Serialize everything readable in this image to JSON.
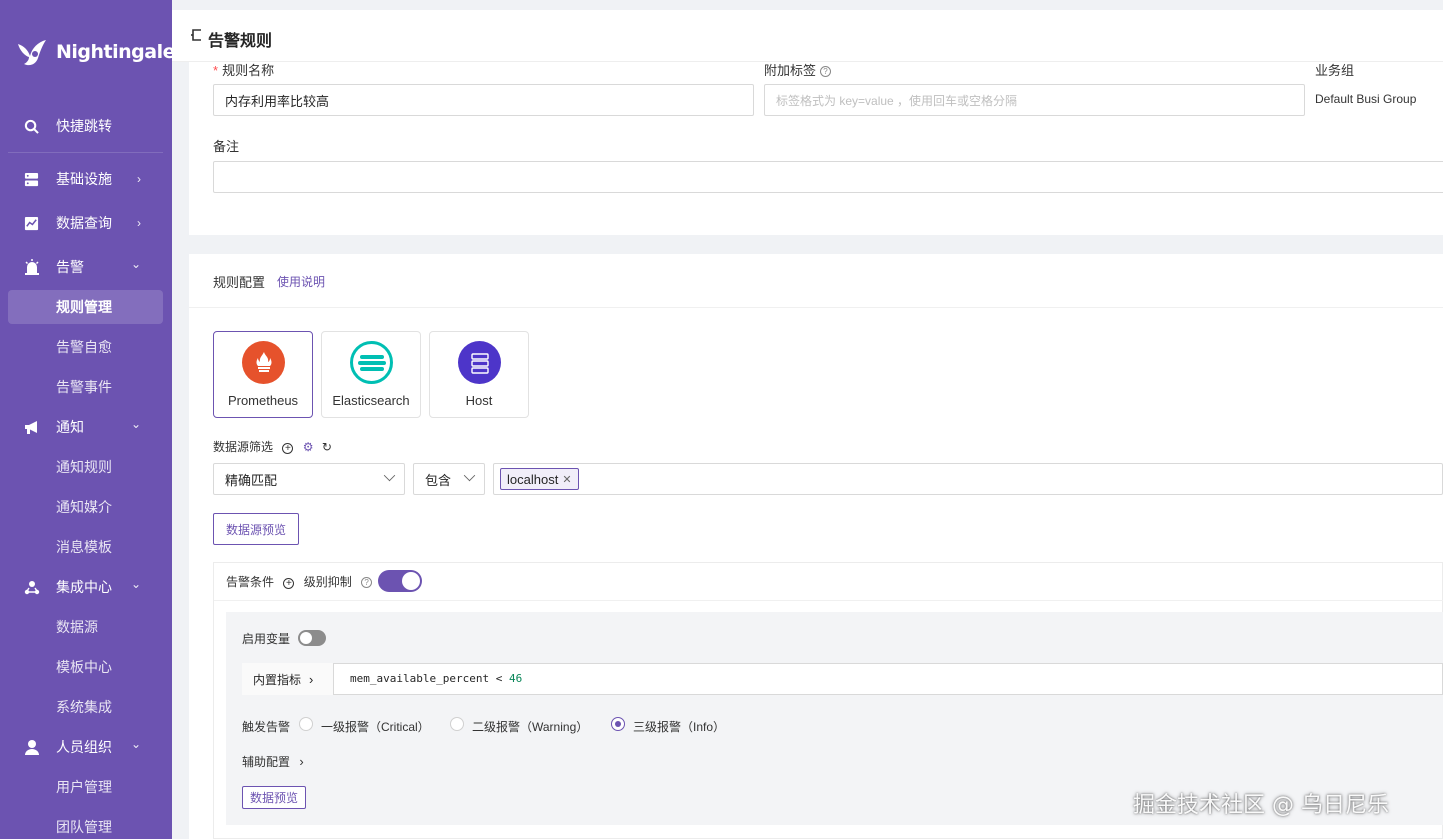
{
  "app": {
    "name": "Nightingale"
  },
  "colors": {
    "brand": "#6c53b1",
    "prometheus": "#e6522c",
    "elasticsearch": "#00bfb3",
    "host": "#4d35c9"
  },
  "sidebar": {
    "items": [
      {
        "label": "快捷跳转",
        "icon": "search-icon"
      },
      {
        "label": "基础设施",
        "icon": "server-icon",
        "chevron": "›"
      },
      {
        "label": "数据查询",
        "icon": "chart-icon",
        "chevron": "›"
      },
      {
        "label": "告警",
        "icon": "alarm-icon",
        "chevron": "⌄"
      },
      {
        "label": "规则管理",
        "active": true
      },
      {
        "label": "告警自愈"
      },
      {
        "label": "告警事件"
      },
      {
        "label": "通知",
        "icon": "megaphone-icon",
        "chevron": "⌄"
      },
      {
        "label": "通知规则"
      },
      {
        "label": "通知媒介"
      },
      {
        "label": "消息模板"
      },
      {
        "label": "集成中心",
        "icon": "integration-icon",
        "chevron": "⌄"
      },
      {
        "label": "数据源"
      },
      {
        "label": "模板中心"
      },
      {
        "label": "系统集成"
      },
      {
        "label": "人员组织",
        "icon": "user-icon",
        "chevron": "⌄"
      },
      {
        "label": "用户管理"
      },
      {
        "label": "团队管理"
      }
    ]
  },
  "header": {
    "back_icon": "back-icon",
    "title": "告警规则"
  },
  "basic": {
    "rule_name_label": "规则名称",
    "rule_name_value": "内存利用率比较高",
    "tags_label": "附加标签",
    "tags_placeholder": "标签格式为 key=value ，使用回车或空格分隔",
    "group_label": "业务组",
    "group_value": "Default Busi Group",
    "note_label": "备注",
    "note_value": ""
  },
  "rule_config": {
    "title": "规则配置",
    "help_link": "使用说明",
    "datasources": [
      {
        "name": "Prometheus",
        "icon": "prometheus-icon",
        "selected": true
      },
      {
        "name": "Elasticsearch",
        "icon": "elasticsearch-icon"
      },
      {
        "name": "Host",
        "icon": "host-icon"
      }
    ],
    "filter_label": "数据源筛选",
    "match_select": "精确匹配",
    "op_select": "包含",
    "tag_value": "localhost",
    "preview_button": "数据源预览"
  },
  "alert_condition": {
    "label": "告警条件",
    "level_suppress_label": "级别抑制",
    "level_suppress_on": true,
    "enable_var_label": "启用变量",
    "enable_var_on": false,
    "metric_prefix": "内置指标",
    "query_metric": "mem_available_percent",
    "query_op": "<",
    "query_threshold": "46",
    "trigger_label": "触发告警",
    "levels": [
      {
        "label": "一级报警（Critical）",
        "checked": false
      },
      {
        "label": "二级报警（Warning）",
        "checked": false
      },
      {
        "label": "三级报警（Info）",
        "checked": true
      }
    ],
    "aux_config_label": "辅助配置",
    "data_preview_button": "数据预览"
  },
  "watermark": "掘金技术社区 @ 乌日尼乐"
}
